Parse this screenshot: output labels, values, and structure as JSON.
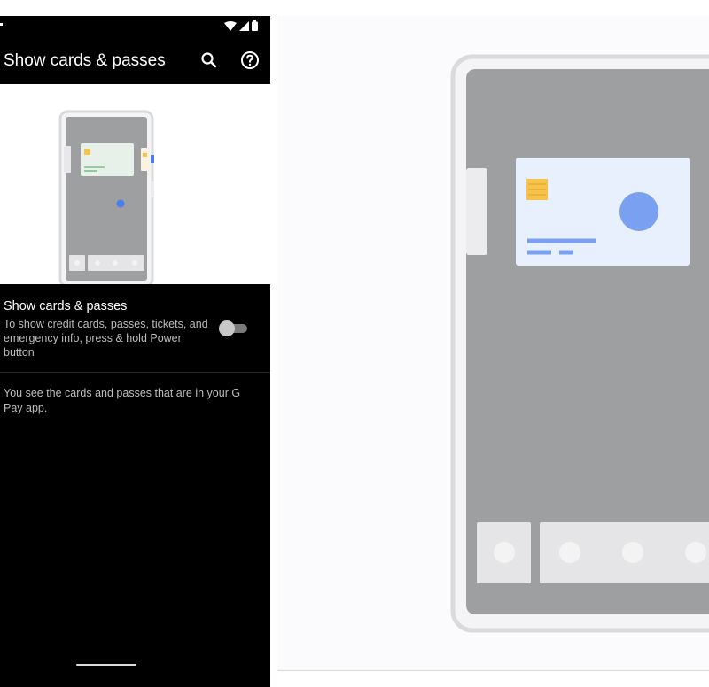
{
  "status_bar": {
    "icons": [
      "wifi-icon",
      "cellular-icon",
      "battery-icon"
    ]
  },
  "app_bar": {
    "title": "Show cards & passes",
    "actions": [
      "search-icon",
      "help-icon"
    ]
  },
  "setting": {
    "title": "Show cards & passes",
    "description": "To show credit cards, passes, tickets, and emergency info, press & hold Power button",
    "toggle_on": false
  },
  "info": {
    "text": "You see the cards and passes that are in your G Pay app."
  },
  "colors": {
    "background_dark": "#000000",
    "phone_screen": "#9e9fa1",
    "card": "#e8f0fd",
    "card_chip": "#f6c24a",
    "accent_blue": "#7aa0f2",
    "frame": "#d9dadc"
  }
}
